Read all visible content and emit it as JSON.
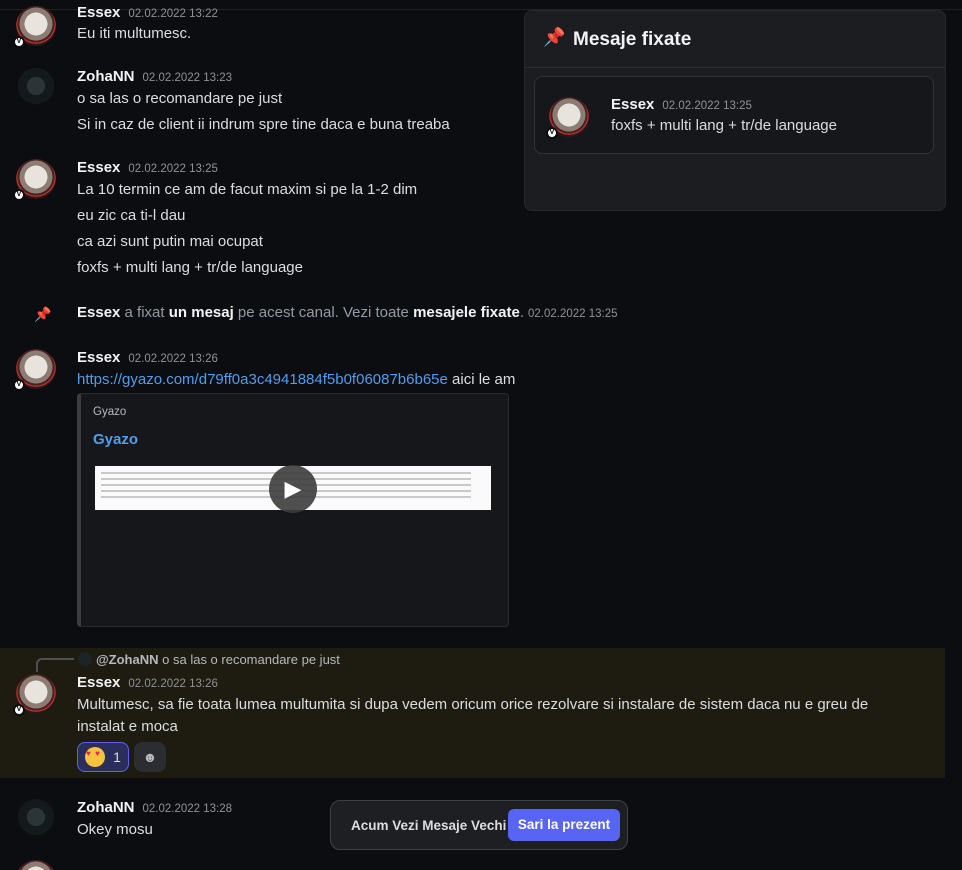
{
  "messages": {
    "m1": {
      "user": "Essex",
      "time": "02.02.2022 13:22",
      "lines": [
        "Eu iti multumesc."
      ]
    },
    "m2": {
      "user": "ZohaNN",
      "time": "02.02.2022 13:23",
      "lines": [
        "o sa las o recomandare pe just",
        "Si in caz de client ii indrum spre tine daca e buna treaba"
      ]
    },
    "m3": {
      "user": "Essex",
      "time": "02.02.2022 13:25",
      "lines": [
        "La 10 termin ce am de facut maxim si pe la 1-2 dim",
        "eu zic ca ti-l dau",
        "ca azi sunt putin mai ocupat",
        "foxfs + multi lang + tr/de language"
      ]
    },
    "system": {
      "user": "Essex",
      "t1": " a fixat ",
      "link1": "un mesaj",
      "t2": " pe acest canal. Vezi toate ",
      "link2": "mesajele fixate",
      "t3": ".",
      "time": "02.02.2022 13:25"
    },
    "m4": {
      "user": "Essex",
      "time": "02.02.2022 13:26",
      "link": "https://gyazo.com/d79ff0a3c4941884f5b0f06087b6b65e",
      "after": " aici le am",
      "embed": {
        "provider": "Gyazo",
        "title": "Gyazo"
      }
    },
    "m5": {
      "reply_user": "@ZohaNN",
      "reply_text": "o sa las o recomandare pe just",
      "user": "Essex",
      "time": "02.02.2022 13:26",
      "lines": [
        "Multumesc, sa fie toata lumea multumita si dupa vedem oricum orice rezolvare si instalare de sistem daca nu e greu de",
        "instalat e moca"
      ],
      "reaction_count": "1"
    },
    "m6": {
      "user": "ZohaNN",
      "time": "02.02.2022 13:28",
      "lines": [
        "Okey mosu"
      ]
    }
  },
  "pinned": {
    "title": "Mesaje fixate",
    "user": "Essex",
    "time": "02.02.2022 13:25",
    "text": "foxfs + multi lang + tr/de language"
  },
  "jump_bar": {
    "text": "Acum Vezi Mesaje Vechi",
    "button": "Sari la prezent"
  },
  "icons": {
    "pin": "pin-icon",
    "play": "play-icon",
    "add_reaction": "add-reaction-icon",
    "emoji": "heart-eyes-emoji"
  },
  "colors": {
    "accent": "#5865f2",
    "link": "#4f9ef0",
    "highlight_bg": "#1e1b10"
  }
}
